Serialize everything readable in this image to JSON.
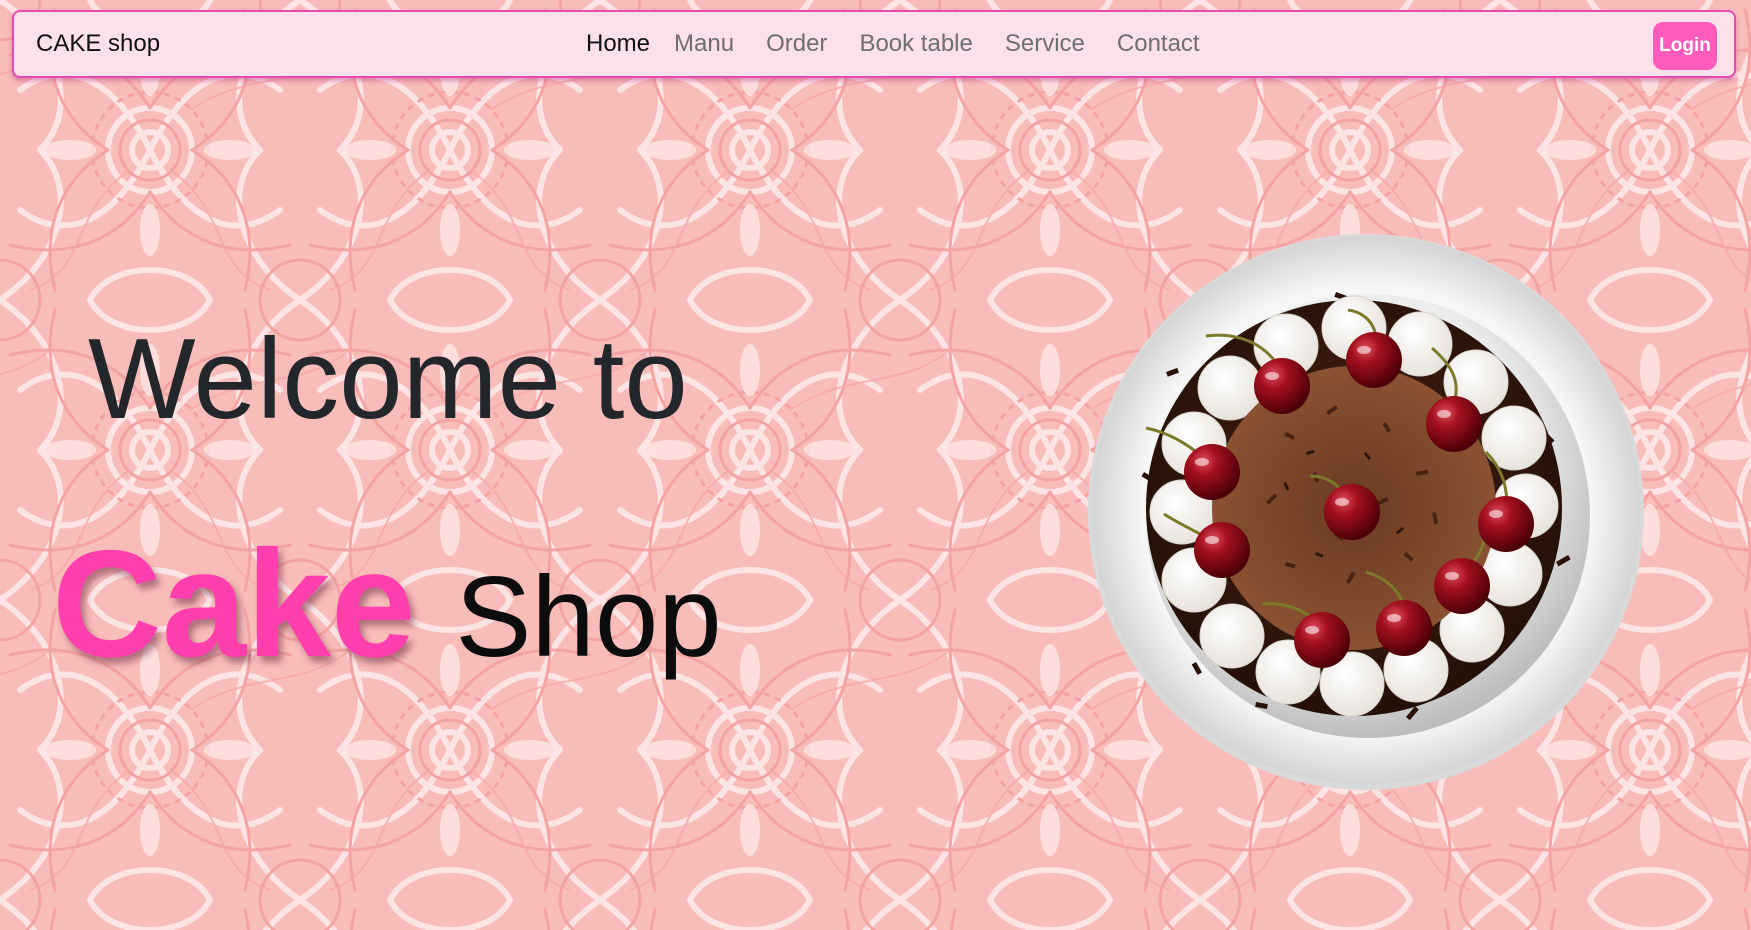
{
  "navbar": {
    "brand": "CAKE shop",
    "items": [
      {
        "label": "Home",
        "active": true
      },
      {
        "label": "Manu",
        "active": false
      },
      {
        "label": "Order",
        "active": false
      },
      {
        "label": "Book table",
        "active": false
      },
      {
        "label": "Service",
        "active": false
      },
      {
        "label": "Contact",
        "active": false
      }
    ],
    "login_label": "Login"
  },
  "hero": {
    "welcome": "Welcome to",
    "cake_word": "Cake",
    "shop_word": "Shop"
  },
  "colors": {
    "accent": "#ff3fae",
    "nav_background": "#fde1ea",
    "nav_border": "#e24bb0",
    "login_button": "#ff5bbd",
    "page_background": "#f8b6b2"
  },
  "icons": {
    "cake_image": "black-forest-cake-plate-image",
    "background": "floral-mandala-pattern"
  }
}
